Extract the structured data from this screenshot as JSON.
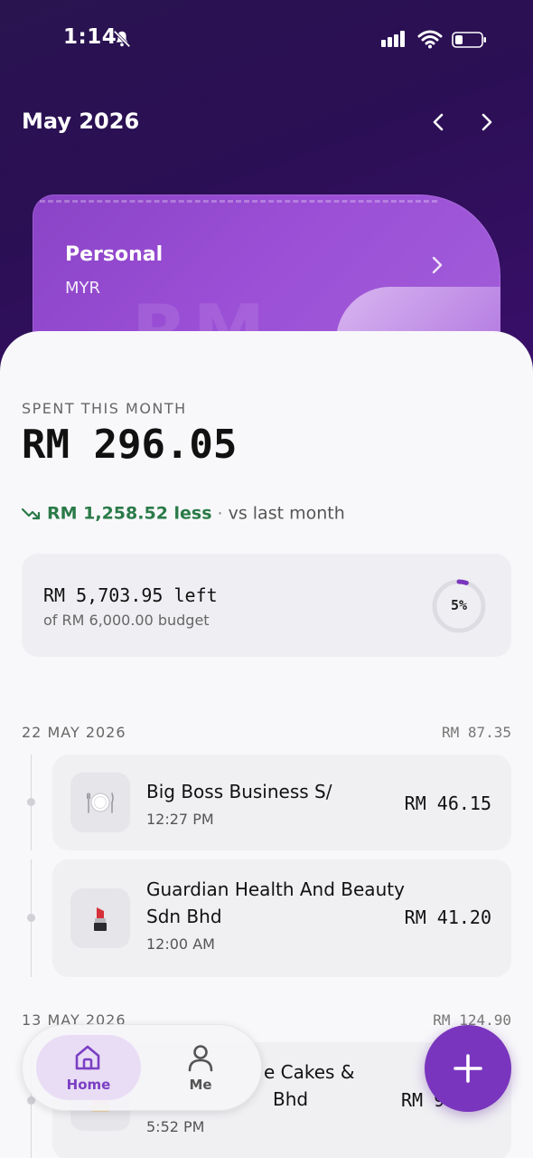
{
  "status_bar": {
    "time": "1:14"
  },
  "header": {
    "month": "May 2026"
  },
  "account_card": {
    "title": "Personal",
    "currency": "MYR",
    "watermark": "RM"
  },
  "summary": {
    "spent_label": "SPENT THIS MONTH",
    "spent_amount": "RM 296.05",
    "trend_amount": "RM 1,258.52 less",
    "trend_separator": "·",
    "trend_suffix": "vs last month"
  },
  "budget": {
    "left_text": "RM 5,703.95 left",
    "of_text": "of RM 6,000.00 budget",
    "percent_label": "5%",
    "percent_value": 0.05,
    "accent_color": "#7a35be"
  },
  "days": [
    {
      "date": "22 MAY 2026",
      "total": "RM 87.35",
      "transactions": [
        {
          "name": "Big Boss Business S/",
          "time": "12:27 PM",
          "amount": "RM 46.15",
          "icon": "plate-cutlery-icon"
        },
        {
          "name": "Guardian Health And Beauty Sdn Bhd",
          "time": "12:00 AM",
          "amount": "RM 41.20",
          "icon": "lipstick-icon"
        }
      ]
    },
    {
      "date": "13 MAY 2026",
      "total": "RM 124.90",
      "transactions": [
        {
          "name": "e Cakes &",
          "name_line2": "Bhd",
          "time": "5:52 PM",
          "amount": "RM 9",
          "icon": "cake-icon"
        }
      ]
    }
  ],
  "bottom_nav": {
    "items": [
      {
        "label": "Home",
        "icon": "home-icon",
        "active": true
      },
      {
        "label": "Me",
        "icon": "person-icon",
        "active": false
      }
    ]
  },
  "fab": {
    "icon": "plus-icon"
  },
  "colors": {
    "accent": "#7a35be",
    "positive": "#2a7a48"
  }
}
